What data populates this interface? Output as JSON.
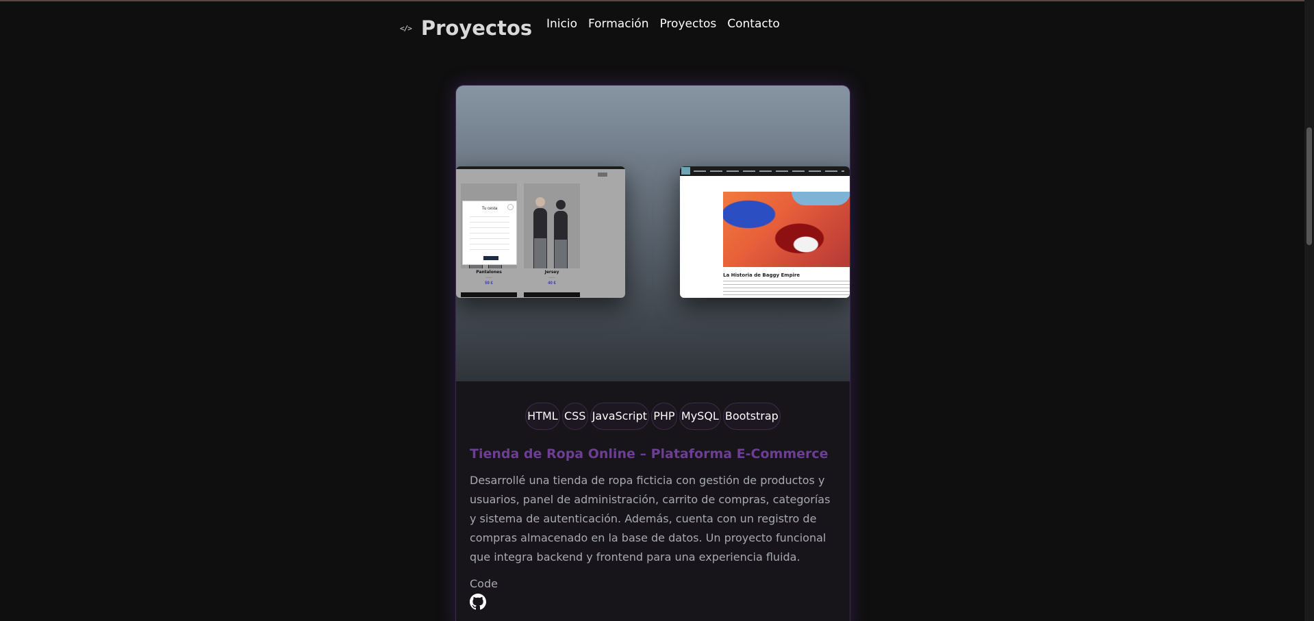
{
  "header": {
    "brand_icon": "code-icon",
    "brand_icon_glyph": "</>",
    "title": "Proyectos",
    "nav": [
      {
        "label": "Inicio"
      },
      {
        "label": "Formación"
      },
      {
        "label": "Proyectos"
      },
      {
        "label": "Contacto"
      }
    ]
  },
  "project": {
    "preview_left": {
      "modal_title": "Tu cesta",
      "products": [
        {
          "name": "Pantalones",
          "price": "59 €"
        },
        {
          "name": "Jersey",
          "price": "40 €"
        }
      ]
    },
    "preview_right": {
      "heading": "La Historia de Baggy Empire"
    },
    "tags": [
      "HTML",
      "CSS",
      "JavaScript",
      "PHP",
      "MySQL",
      "Bootstrap"
    ],
    "title": "Tienda de Ropa Online – Plataforma E-Commerce",
    "description": "Desarrollé una tienda de ropa ficticia con gestión de productos y usuarios, panel de administración, carrito de compras, categorías y sistema de autenticación. Además, cuenta con un registro de compras almacenado en la base de datos. Un proyecto funcional que integra backend y frontend para una experiencia fluida.",
    "code_label": "Code",
    "code_icon": "github-icon"
  },
  "colors": {
    "background": "#0f0f0f",
    "card": "#17141a",
    "accent": "#6d3f94",
    "text_muted": "#a7abb2"
  }
}
